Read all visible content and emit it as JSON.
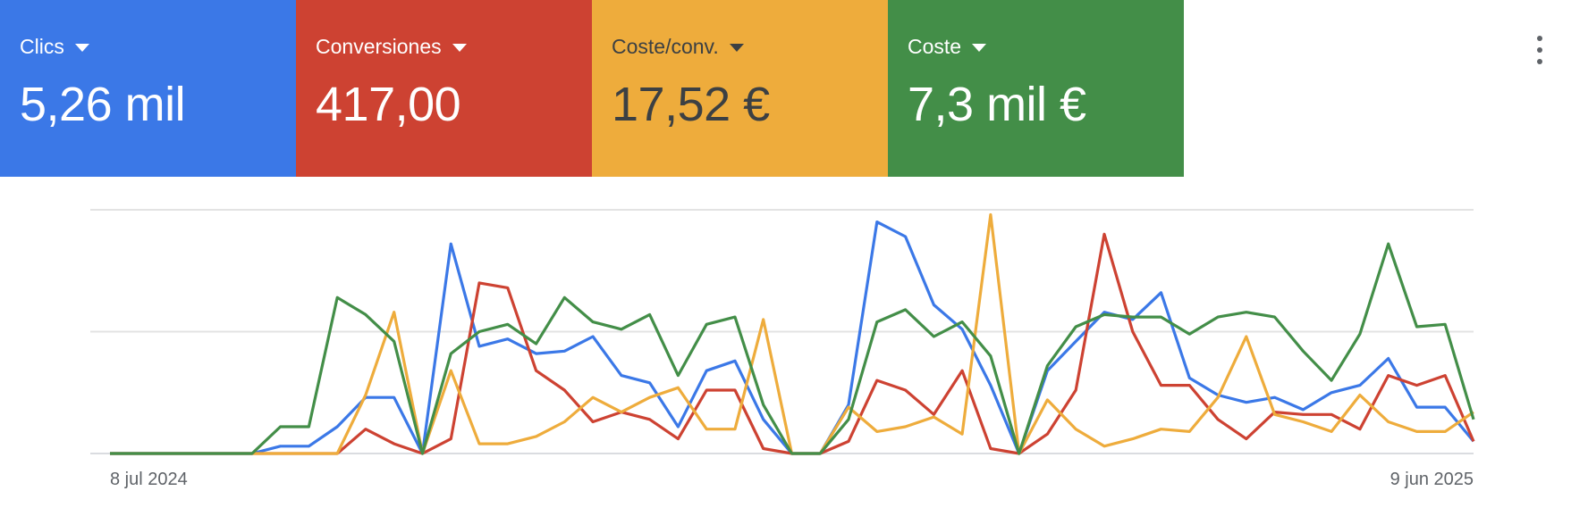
{
  "metric_cards": [
    {
      "label": "Clics",
      "value": "5,26 mil",
      "bg": "#3b78e7",
      "fg": "#ffffff"
    },
    {
      "label": "Conversiones",
      "value": "417,00",
      "bg": "#cd4232",
      "fg": "#ffffff"
    },
    {
      "label": "Coste/conv.",
      "value": "17,52 €",
      "bg": "#eeac3c",
      "fg": "#3c4043"
    },
    {
      "label": "Coste",
      "value": "7,3 mil €",
      "bg": "#438e48",
      "fg": "#ffffff"
    }
  ],
  "more_menu": {
    "icon": "more-vert-icon"
  },
  "chart_data": {
    "type": "line",
    "x_labels": {
      "start": "8 jul 2024",
      "end": "9 jun 2025"
    },
    "grid": true,
    "ylim": [
      0,
      100
    ],
    "gridlines": [
      0,
      50,
      100
    ],
    "series": [
      {
        "color": "#3b78e7",
        "values": [
          0,
          0,
          0,
          0,
          0,
          0,
          3,
          3,
          11,
          23,
          23,
          0,
          86,
          44,
          47,
          41,
          42,
          48,
          32,
          29,
          11,
          34,
          38,
          14,
          0,
          0,
          20,
          95,
          89,
          61,
          51,
          28,
          0,
          34,
          46,
          58,
          55,
          66,
          31,
          24,
          21,
          23,
          18,
          25,
          28,
          39,
          19,
          19,
          5
        ]
      },
      {
        "color": "#cd4232",
        "values": [
          0,
          0,
          0,
          0,
          0,
          0,
          0,
          0,
          0,
          10,
          4,
          0,
          6,
          70,
          68,
          34,
          26,
          13,
          17,
          14,
          6,
          26,
          26,
          2,
          0,
          0,
          5,
          30,
          26,
          16,
          34,
          2,
          0,
          8,
          26,
          90,
          50,
          28,
          28,
          14,
          6,
          17,
          16,
          16,
          10,
          32,
          28,
          32,
          5
        ]
      },
      {
        "color": "#eeac3c",
        "values": [
          0,
          0,
          0,
          0,
          0,
          0,
          0,
          0,
          0,
          24,
          58,
          0,
          34,
          4,
          4,
          7,
          13,
          23,
          17,
          23,
          27,
          10,
          10,
          55,
          0,
          0,
          19,
          9,
          11,
          15,
          8,
          98,
          0,
          22,
          10,
          3,
          6,
          10,
          9,
          23,
          48,
          16,
          13,
          9,
          24,
          13,
          9,
          9,
          17
        ]
      },
      {
        "color": "#438e48",
        "values": [
          0,
          0,
          0,
          0,
          0,
          0,
          11,
          11,
          64,
          57,
          46,
          0,
          41,
          50,
          53,
          45,
          64,
          54,
          51,
          57,
          32,
          53,
          56,
          20,
          0,
          0,
          14,
          54,
          59,
          48,
          54,
          40,
          0,
          36,
          52,
          57,
          56,
          56,
          49,
          56,
          58,
          56,
          42,
          30,
          49,
          86,
          52,
          53,
          14
        ]
      }
    ]
  }
}
